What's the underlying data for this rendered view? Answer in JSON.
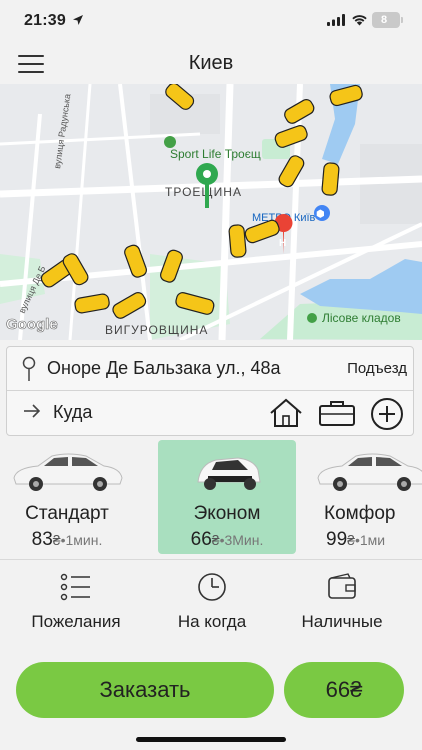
{
  "status_bar": {
    "time": "21:39",
    "battery": "8",
    "battery_color": "#c9c9c9"
  },
  "header": {
    "city": "Киев",
    "menu_icon": "hamburger-icon"
  },
  "map": {
    "labels": {
      "sport_life": "Sport Life Троєщ",
      "troeshchina": "ТРОЕЩИНА",
      "metro": "МЕТРО Київ",
      "vygurovshchina": "ВИГУРОВЩИНА",
      "lisove": "Лісове кладов",
      "radunska": "вулиця Радунська",
      "de_balzaka": "вулиця Де Б",
      "google": "Google"
    },
    "colors": {
      "taxi": "#f5c518",
      "park": "#c8ecd3",
      "water": "#9fcbf2",
      "road": "#ffffff",
      "pin": "#2fa84f"
    }
  },
  "address": {
    "from": "Оноре Де Бальзака ул., 48а",
    "entrance": "Подъезд",
    "to_placeholder": "Куда",
    "icons": [
      "home-icon",
      "briefcase-icon",
      "add-icon"
    ]
  },
  "tariffs": [
    {
      "name": "Стандарт",
      "price": "83",
      "currency": "₴",
      "eta": "•1мин.",
      "active": false
    },
    {
      "name": "Эконом",
      "price": "66",
      "currency": "₴",
      "eta": "•3Мин.",
      "active": true
    },
    {
      "name": "Комфор",
      "price": "99",
      "currency": "₴",
      "eta": "•1ми",
      "active": false
    }
  ],
  "options": [
    {
      "label": "Пожелания",
      "icon": "list-icon"
    },
    {
      "label": "На когда",
      "icon": "clock-icon"
    },
    {
      "label": "Наличные",
      "icon": "wallet-icon"
    }
  ],
  "actions": {
    "order": "Заказать",
    "price": "66₴",
    "accent": "#7ac943",
    "active_tariff_bg": "#a9dfbf"
  }
}
